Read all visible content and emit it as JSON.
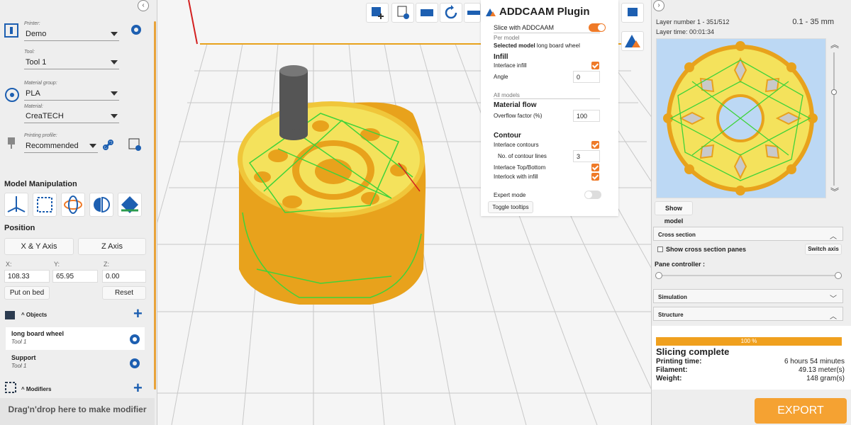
{
  "left_panel": {
    "printer": {
      "label": "Printer:",
      "value": "Demo"
    },
    "tool": {
      "label": "Tool:",
      "value": "Tool 1"
    },
    "material_group": {
      "label": "Material group:",
      "value": "PLA"
    },
    "material": {
      "label": "Material:",
      "value": "CreaTECH"
    },
    "printing_profile": {
      "label": "Printing profile:",
      "value": "Recommended"
    },
    "model_manipulation_title": "Model Manipulation",
    "position_title": "Position",
    "xy_axis_button": "X & Y Axis",
    "z_axis_button": "Z Axis",
    "coords": {
      "x_label": "X:",
      "x_value": "108.33",
      "y_label": "Y:",
      "y_value": "65.95",
      "z_label": "Z:",
      "z_value": "0.00"
    },
    "put_on_bed_button": "Put on bed",
    "reset_button": "Reset",
    "objects_title": "Objects",
    "objects": [
      {
        "name": "long board wheel",
        "tool": "Tool 1"
      },
      {
        "name": "Support",
        "tool": "Tool 1"
      }
    ],
    "modifiers_title": "Modifiers",
    "drop_hint": "Drag'n'drop here to make modifier"
  },
  "plugin": {
    "title": "ADDCAAM Plugin",
    "slice_with": "Slice with ADDCAAM",
    "slice_enabled": true,
    "per_model": "Per model",
    "selected_model_label": "Selected model",
    "selected_model_value": "long board wheel",
    "infill_title": "Infill",
    "interlace_infill": "Interlace infill",
    "angle_label": "Angle",
    "angle_value": "0",
    "all_models": "All models",
    "material_flow_title": "Material flow",
    "overflow_label": "Overflow factor (%)",
    "overflow_value": "100",
    "contour_title": "Contour",
    "interlace_contours": "Interlace contours",
    "contour_lines_label": "No. of contour lines",
    "contour_lines_value": "3",
    "interlace_top_bottom": "Interlace Top/Bottom",
    "interlock_infill": "Interlock with infill",
    "expert_mode": "Expert mode",
    "expert_enabled": false,
    "toggle_tooltips": "Toggle tooltips",
    "accent_color": "#ef7a28"
  },
  "right_panel": {
    "layer_number": "Layer number 1 - 351/512",
    "layer_range": "0.1 - 35 mm",
    "layer_time": "Layer time: 00:01:34",
    "show_model_button": "Show model",
    "cross_section_title": "Cross section",
    "show_cross_section_panes": "Show cross section panes",
    "switch_axis_button": "Switch axis",
    "pane_controller_label": "Pane controller :",
    "simulation_title": "Simulation",
    "structure_title": "Structure",
    "progress_percent": 100,
    "progress_text": "100 %",
    "slicing_status": "Slicing complete",
    "printing_time_label": "Printing time:",
    "printing_time_value": "6 hours 54 minutes",
    "filament_label": "Filament:",
    "filament_value": "49.13 meter(s)",
    "weight_label": "Weight:",
    "weight_value": "148 gram(s)",
    "export_button": "EXPORT"
  },
  "colors": {
    "part_orange": "#e8a21c",
    "part_yellow": "#f4e25c",
    "toolpath_green": "#3fd33a",
    "brand_blue": "#1d5fb1"
  }
}
